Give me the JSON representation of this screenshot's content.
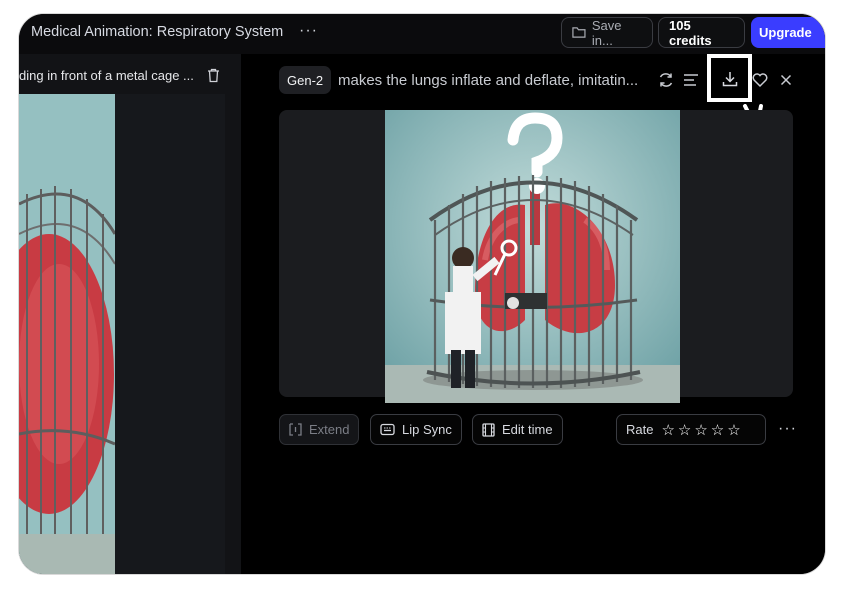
{
  "header": {
    "title": "Medical Animation: Respiratory System",
    "more": "···",
    "save_label": "Save in...",
    "credits_label": "105 credits",
    "upgrade_label": "Upgrade"
  },
  "left_panel": {
    "caption": "ding in front of a metal cage ..."
  },
  "generation": {
    "model": "Gen-2",
    "prompt": "makes the lungs inflate and deflate, imitatin...",
    "icons": [
      "refresh-icon",
      "details-icon",
      "download-icon",
      "heart-icon",
      "close-icon"
    ]
  },
  "actions": {
    "extend": "Extend",
    "lip_sync": "Lip Sync",
    "edit_time": "Edit time",
    "rate": "Rate",
    "stars": "☆☆☆☆☆",
    "more": "···"
  },
  "colors": {
    "accent": "#3a3dff",
    "background": "#000000",
    "panel": "#121316"
  }
}
